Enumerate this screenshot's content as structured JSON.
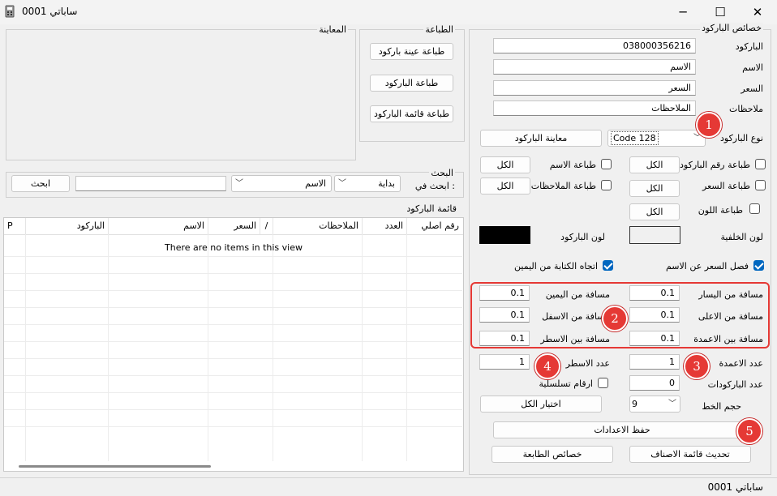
{
  "window": {
    "title": "ساباتي  0001",
    "min_glyph": "─",
    "max_glyph": "☐",
    "close_glyph": "✕"
  },
  "props": {
    "group_title": "خصائص الباركود",
    "barcode_label": "الباركود",
    "barcode_value": "038000356216",
    "name_label": "الاسم",
    "name_value": "الاسم",
    "price_label": "السعر",
    "price_value": "السعر",
    "notes_label": "ملاحظات",
    "notes_value": "الملاحظات",
    "type_label": "نوع الباركود",
    "type_value": "Code 128",
    "preview_button": "معاينة الباركود",
    "print_barcode_number": "طباعة رقم الباركود",
    "print_name": "طباعة الاسم",
    "print_price": "طباعة السعر",
    "print_notes": "طباعة الملاحظات",
    "print_color": "طباعة اللون",
    "all_label": "الكل",
    "background_label": "لون الخلفية",
    "barcode_color_label": "لون الباركود",
    "separate_price": "فصل السعر عن الاسم",
    "rtl_direction": "اتجاه الكتابة من اليمين",
    "margin_left_label": "مسافة من اليسار",
    "margin_left_value": "0.1",
    "margin_right_label": "مسافة من اليمين",
    "margin_right_value": "0.1",
    "margin_top_label": "مسافة من الاعلى",
    "margin_top_value": "0.1",
    "margin_bottom_label": "مسافة من الاسفل",
    "margin_bottom_value": "0.1",
    "col_spacing_label": "مسافة بين الاعمدة",
    "col_spacing_value": "0.1",
    "row_spacing_label": "مسافة بين الاسطر",
    "row_spacing_value": "0.1",
    "columns_label": "عدد الاعمدة",
    "columns_value": "1",
    "rows_label": "عدد الاسطر",
    "rows_value": "1",
    "barcode_count_label": "عدد الباركودات",
    "barcode_count_value": "0",
    "serial_numbers": "ارقام تسلسلية",
    "select_all": "اختيار الكل",
    "font_size_label": "حجم الخط",
    "font_size_value": "9",
    "save_settings": "حفظ الاعدادات",
    "refresh_items": "تحديث قائمة الاصناف",
    "printer_props": "خصائص الطابعة",
    "separate_price_checked": true,
    "rtl_checked": true,
    "background_color": "#ffffff",
    "barcode_color": "#000000"
  },
  "printing": {
    "group_title": "الطباعة",
    "print_sample": "طباعة عينة باركود",
    "print_barcode": "طباعة الباركود",
    "print_list": "طباعة قائمة الباركود"
  },
  "preview": {
    "group_title": "المعاينة"
  },
  "search": {
    "group_title": "البحث",
    "search_in_label": "ابحث في :",
    "mode_value": "بداية",
    "field_value": "الاسم",
    "query_value": "",
    "search_button": "ابحث"
  },
  "list": {
    "group_title": "قائمة الباركود",
    "columns": [
      "رقم اصلي",
      "العدد",
      "الملاحظات",
      "/",
      "السعر",
      "الاسم",
      "الباركود",
      "P"
    ],
    "empty_text": "There are no items in this view"
  },
  "badges": [
    "1",
    "2",
    "3",
    "4",
    "5"
  ],
  "annotation_color": "#e53935",
  "status": {
    "text": "ساباتي  0001"
  }
}
